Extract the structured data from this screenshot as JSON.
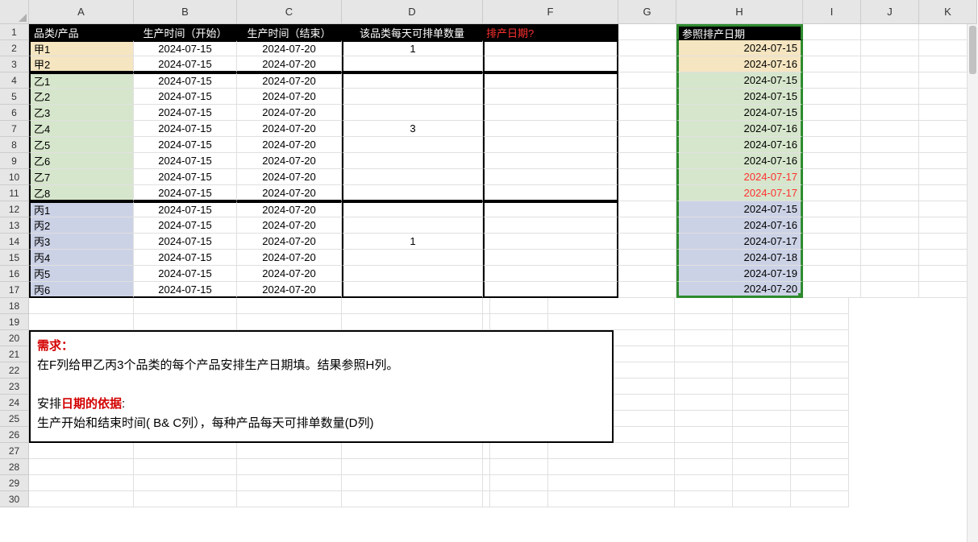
{
  "columns": [
    "A",
    "B",
    "C",
    "D",
    "F",
    "G",
    "H",
    "I",
    "J",
    "K"
  ],
  "colWidths": {
    "A": 130,
    "B": 128,
    "C": 130,
    "D": 175,
    "F": 168,
    "G": 72,
    "H": 157,
    "I": 72,
    "J": 72,
    "K": 72
  },
  "rowCount": 30,
  "header": {
    "A": "品类/产品",
    "B": "生产时间（开始）",
    "C": "生产时间（结束）",
    "D": "该品类每天可排单数量",
    "F": "排产日期?",
    "H": "参照排产日期"
  },
  "groups": [
    {
      "fill": "fillA1",
      "D": "1",
      "rows": [
        {
          "A": "甲1",
          "B": "2024-07-15",
          "C": "2024-07-20"
        },
        {
          "A": "甲2",
          "B": "2024-07-15",
          "C": "2024-07-20"
        }
      ]
    },
    {
      "fill": "fillA2",
      "D": "3",
      "rows": [
        {
          "A": "乙1",
          "B": "2024-07-15",
          "C": "2024-07-20"
        },
        {
          "A": "乙2",
          "B": "2024-07-15",
          "C": "2024-07-20"
        },
        {
          "A": "乙3",
          "B": "2024-07-15",
          "C": "2024-07-20"
        },
        {
          "A": "乙4",
          "B": "2024-07-15",
          "C": "2024-07-20"
        },
        {
          "A": "乙5",
          "B": "2024-07-15",
          "C": "2024-07-20"
        },
        {
          "A": "乙6",
          "B": "2024-07-15",
          "C": "2024-07-20"
        },
        {
          "A": "乙7",
          "B": "2024-07-15",
          "C": "2024-07-20"
        },
        {
          "A": "乙8",
          "B": "2024-07-15",
          "C": "2024-07-20"
        }
      ]
    },
    {
      "fill": "fillA3",
      "D": "1",
      "rows": [
        {
          "A": "丙1",
          "B": "2024-07-15",
          "C": "2024-07-20"
        },
        {
          "A": "丙2",
          "B": "2024-07-15",
          "C": "2024-07-20"
        },
        {
          "A": "丙3",
          "B": "2024-07-15",
          "C": "2024-07-20"
        },
        {
          "A": "丙4",
          "B": "2024-07-15",
          "C": "2024-07-20"
        },
        {
          "A": "丙5",
          "B": "2024-07-15",
          "C": "2024-07-20"
        },
        {
          "A": "丙6",
          "B": "2024-07-15",
          "C": "2024-07-20"
        }
      ]
    }
  ],
  "refH": [
    {
      "v": "2024-07-15",
      "fill": "fillH1"
    },
    {
      "v": "2024-07-16",
      "fill": "fillH1"
    },
    {
      "v": "2024-07-15",
      "fill": "fillH2"
    },
    {
      "v": "2024-07-15",
      "fill": "fillH2"
    },
    {
      "v": "2024-07-15",
      "fill": "fillH2"
    },
    {
      "v": "2024-07-16",
      "fill": "fillH2"
    },
    {
      "v": "2024-07-16",
      "fill": "fillH2"
    },
    {
      "v": "2024-07-16",
      "fill": "fillH2"
    },
    {
      "v": "2024-07-17",
      "fill": "fillH2",
      "red": true
    },
    {
      "v": "2024-07-17",
      "fill": "fillH2",
      "red": true
    },
    {
      "v": "2024-07-15",
      "fill": "fillH3"
    },
    {
      "v": "2024-07-16",
      "fill": "fillH3"
    },
    {
      "v": "2024-07-17",
      "fill": "fillH3"
    },
    {
      "v": "2024-07-18",
      "fill": "fillH3"
    },
    {
      "v": "2024-07-19",
      "fill": "fillH3"
    },
    {
      "v": "2024-07-20",
      "fill": "fillH3"
    }
  ],
  "note": {
    "l1a": "需求：",
    "l2": "在F列给甲乙丙3个品类的每个产品安排生产日期填。结果参照H列。",
    "l4a": "安排",
    "l4b": "日期的依据",
    "l4c": ":",
    "l5": "生产开始和结束时间( B& C列），每种产品每天可排单数量(D列)"
  }
}
